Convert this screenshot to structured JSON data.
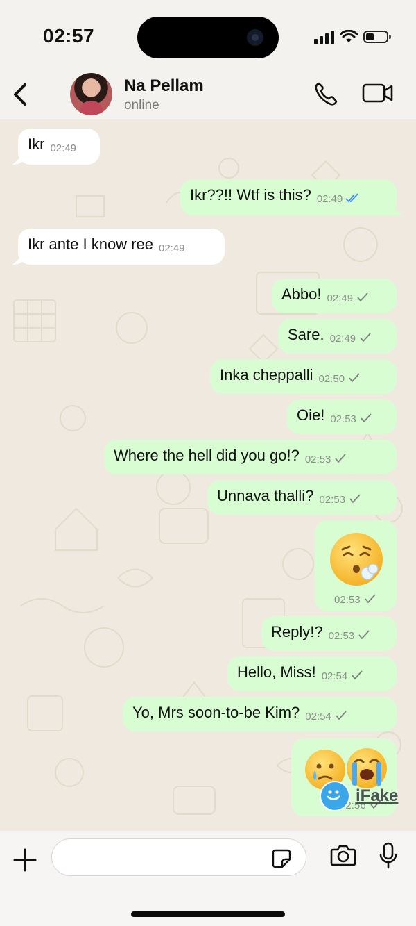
{
  "status_bar": {
    "time": "02:57"
  },
  "header": {
    "contact_name": "Na Pellam",
    "presence": "online"
  },
  "messages": [
    {
      "dir": "in",
      "text": "Ikr",
      "time": "02:49"
    },
    {
      "dir": "out",
      "text": "Ikr??!! Wtf is this?",
      "time": "02:49",
      "status": "read"
    },
    {
      "dir": "in",
      "text": "Ikr ante I know ree",
      "time": "02:49"
    },
    {
      "dir": "out",
      "text": "Abbo!",
      "time": "02:49",
      "status": "sent"
    },
    {
      "dir": "out",
      "text": "Sare.",
      "time": "02:49",
      "status": "sent"
    },
    {
      "dir": "out",
      "text": "Inka cheppalli",
      "time": "02:50",
      "status": "sent"
    },
    {
      "dir": "out",
      "text": "Oie!",
      "time": "02:53",
      "status": "sent"
    },
    {
      "dir": "out",
      "text": "Where the hell did you go!?",
      "time": "02:53",
      "status": "sent"
    },
    {
      "dir": "out",
      "text": "Unnava thalli?",
      "time": "02:53",
      "status": "sent"
    },
    {
      "dir": "out",
      "emoji": "face-exhaling",
      "time": "02:53",
      "status": "sent"
    },
    {
      "dir": "out",
      "text": "Reply!?",
      "time": "02:53",
      "status": "sent"
    },
    {
      "dir": "out",
      "text": "Hello, Miss!",
      "time": "02:54",
      "status": "sent"
    },
    {
      "dir": "out",
      "text": "Yo, Mrs soon-to-be Kim?",
      "time": "02:54",
      "status": "sent"
    },
    {
      "dir": "out",
      "emoji": "face-holding-back-tears + loudly-crying-face",
      "time": "02:56",
      "status": "sent"
    }
  ],
  "composer": {
    "text": ""
  },
  "watermark": {
    "text": "iFake"
  },
  "colors": {
    "incoming": "#ffffff",
    "outgoing": "#d9fdd3",
    "read_tick": "#3d8bf2",
    "sent_tick": "#7c807c",
    "background": "#efe9df"
  },
  "icons": [
    "back-chevron-icon",
    "phone-icon",
    "video-camera-icon",
    "plus-icon",
    "sticker-icon",
    "camera-icon",
    "microphone-icon"
  ]
}
